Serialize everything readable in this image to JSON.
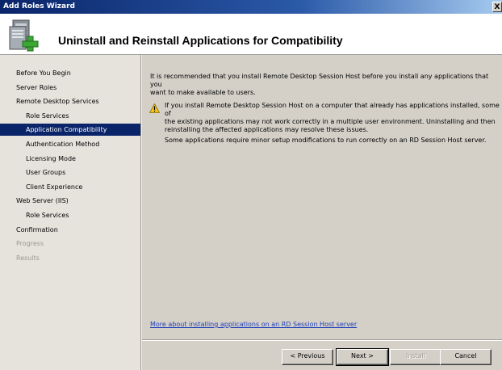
{
  "window": {
    "title": "Add Roles Wizard",
    "close_glyph": "X"
  },
  "header": {
    "title": "Uninstall and Reinstall Applications for Compatibility",
    "icon": "server-roles-add-icon"
  },
  "sidebar": {
    "items": [
      {
        "label": "Before You Begin",
        "level": 1,
        "state": "normal"
      },
      {
        "label": "Server Roles",
        "level": 1,
        "state": "normal"
      },
      {
        "label": "Remote Desktop Services",
        "level": 1,
        "state": "normal"
      },
      {
        "label": "Role Services",
        "level": 2,
        "state": "normal"
      },
      {
        "label": "Application Compatibility",
        "level": 2,
        "state": "selected"
      },
      {
        "label": "Authentication Method",
        "level": 2,
        "state": "normal"
      },
      {
        "label": "Licensing Mode",
        "level": 2,
        "state": "normal"
      },
      {
        "label": "User Groups",
        "level": 2,
        "state": "normal"
      },
      {
        "label": "Client Experience",
        "level": 2,
        "state": "normal"
      },
      {
        "label": "Web Server (IIS)",
        "level": 1,
        "state": "normal"
      },
      {
        "label": "Role Services",
        "level": 2,
        "state": "normal"
      },
      {
        "label": "Confirmation",
        "level": 1,
        "state": "normal"
      },
      {
        "label": "Progress",
        "level": 1,
        "state": "disabled"
      },
      {
        "label": "Results",
        "level": 1,
        "state": "disabled"
      }
    ]
  },
  "main": {
    "intro_line1": "It is recommended that you install Remote Desktop Session Host before you install any applications that you",
    "intro_line2": "want to make available to users.",
    "warning_line1": "If you install Remote Desktop Session Host on a computer that already has applications installed, some of",
    "warning_line2": "the existing applications may not work correctly in a multiple user environment. Uninstalling and then",
    "warning_line3": "reinstalling the affected applications may resolve these issues.",
    "note": "Some applications require minor setup modifications to run correctly on an RD Session Host server.",
    "more_link": "More about installing applications on an RD Session Host server"
  },
  "buttons": {
    "previous": "< Previous",
    "next": "Next >",
    "install": "Install",
    "cancel": "Cancel"
  },
  "colors": {
    "selected_bg": "#0a246a",
    "link": "#1f3fb8",
    "warning": "#f5c518"
  }
}
